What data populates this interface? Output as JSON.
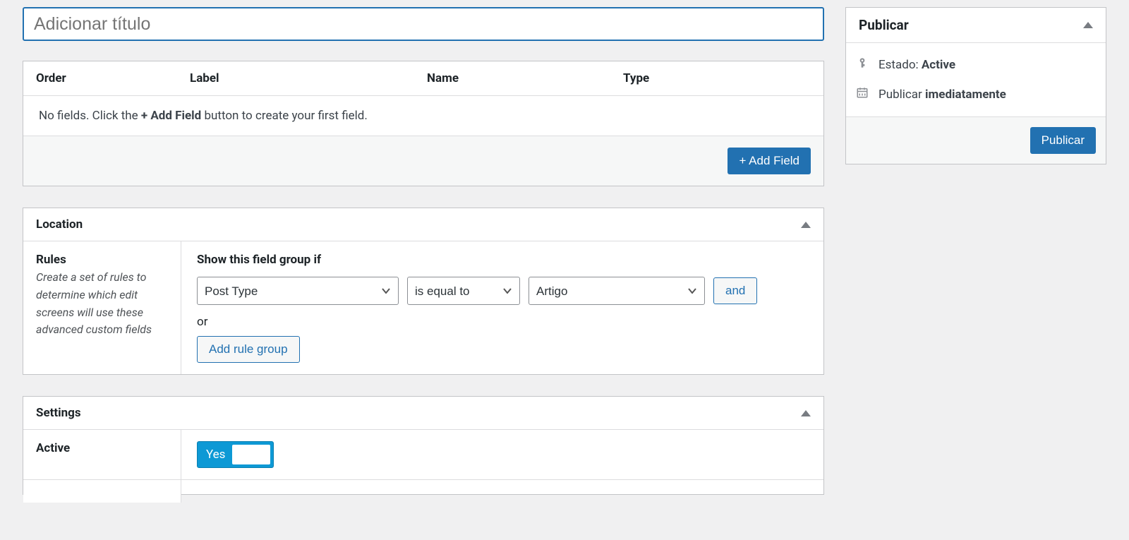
{
  "title_field": {
    "placeholder": "Adicionar título",
    "value": ""
  },
  "fields_table": {
    "headers": {
      "order": "Order",
      "label": "Label",
      "name": "Name",
      "type": "Type"
    },
    "empty_before": "No fields. Click the ",
    "empty_bold": "+ Add Field",
    "empty_after": " button to create your first field.",
    "add_field_button": "+ Add Field"
  },
  "location": {
    "heading": "Location",
    "rules_label": "Rules",
    "rules_desc": "Create a set of rules to determine which edit screens will use these advanced custom fields",
    "show_if_label": "Show this field group if",
    "param_selected": "Post Type",
    "operator_selected": "is equal to",
    "value_selected": "Artigo",
    "and_button": "and",
    "or_text": "or",
    "add_rule_group_button": "Add rule group"
  },
  "settings": {
    "heading": "Settings",
    "active_label": "Active",
    "active_value": "Yes"
  },
  "publish": {
    "heading": "Publicar",
    "status_label": "Estado: ",
    "status_value": "Active",
    "schedule_label": "Publicar ",
    "schedule_value": "imediatamente",
    "publish_button": "Publicar"
  }
}
